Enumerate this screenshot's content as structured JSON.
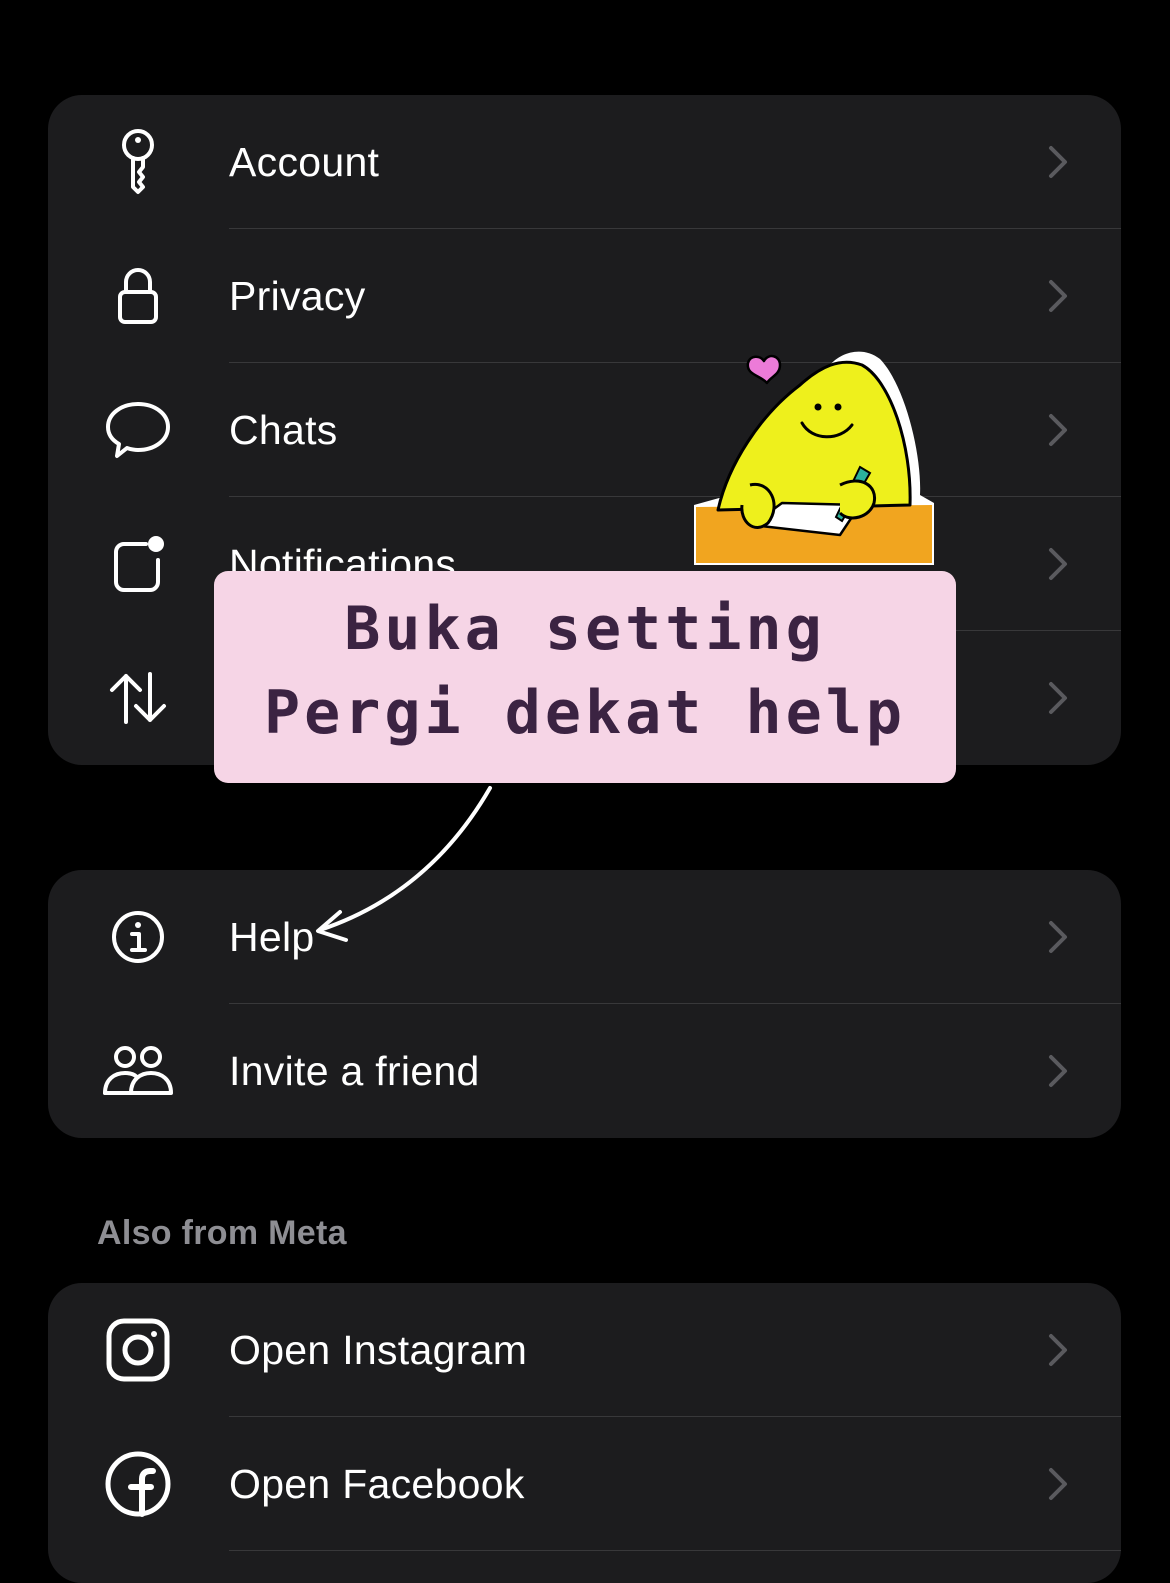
{
  "settings_group_1": {
    "items": [
      {
        "label": "Account",
        "icon": "key-icon"
      },
      {
        "label": "Privacy",
        "icon": "lock-icon"
      },
      {
        "label": "Chats",
        "icon": "chat-bubble-icon"
      },
      {
        "label": "Notifications",
        "icon": "notification-badge-icon"
      },
      {
        "label": "",
        "icon": "data-transfer-arrows-icon"
      }
    ]
  },
  "settings_group_2": {
    "items": [
      {
        "label": "Help",
        "icon": "info-icon"
      },
      {
        "label": "Invite a friend",
        "icon": "people-icon"
      }
    ]
  },
  "meta_section": {
    "header": "Also from Meta",
    "items": [
      {
        "label": "Open Instagram",
        "icon": "instagram-icon"
      },
      {
        "label": "Open Facebook",
        "icon": "facebook-icon"
      }
    ]
  },
  "annotation": {
    "line1": "Buka setting",
    "line2": "Pergi dekat help"
  },
  "colors": {
    "background": "#000000",
    "card": "#1c1c1e",
    "divider": "#38383a",
    "chevron": "#5a5a5e",
    "section_header": "#8e8e93",
    "note_background": "#f6d5e6",
    "note_text": "#3b2342"
  }
}
